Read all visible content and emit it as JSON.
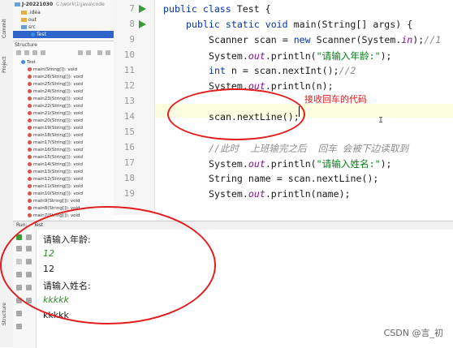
{
  "project": {
    "root_label": "J-20221030",
    "root_path": "C:\\work\\1\\java\\code",
    "items": [
      ".idea",
      "out",
      "src",
      "Test"
    ]
  },
  "structure": {
    "title": "Structure",
    "class_name": "Test",
    "methods": [
      "main(String[]): void",
      "main26(String[]): void",
      "main25(String[]): void",
      "main24(String[]): void",
      "main23(String[]): void",
      "main22(String[]): void",
      "main21(String[]): void",
      "main20(String[]): void",
      "main19(String[]): void",
      "main18(String[]): void",
      "main17(String[]): void",
      "main16(String[]): void",
      "main15(String[]): void",
      "main14(String[]): void",
      "main13(String[]): void",
      "main12(String[]): void",
      "main11(String[]): void",
      "main10(String[]): void",
      "main9(String[]): void",
      "main8(String[]): void",
      "main7(String[]): void"
    ]
  },
  "left_tabs": [
    "Commit",
    "Project",
    "Structure"
  ],
  "editor": {
    "line_numbers": [
      "7",
      "8",
      "9",
      "10",
      "11",
      "12",
      "13",
      "14",
      "15",
      "16",
      "17",
      "18",
      "19"
    ],
    "annotation": "接收回车的代码"
  },
  "run": {
    "tab_label": "Run:",
    "config_name": "Test",
    "console": [
      "请输入年龄:",
      "12",
      "12",
      "请输入姓名:",
      "kkkkk",
      "kkkkk"
    ]
  },
  "watermark": "CSDN @言_初"
}
